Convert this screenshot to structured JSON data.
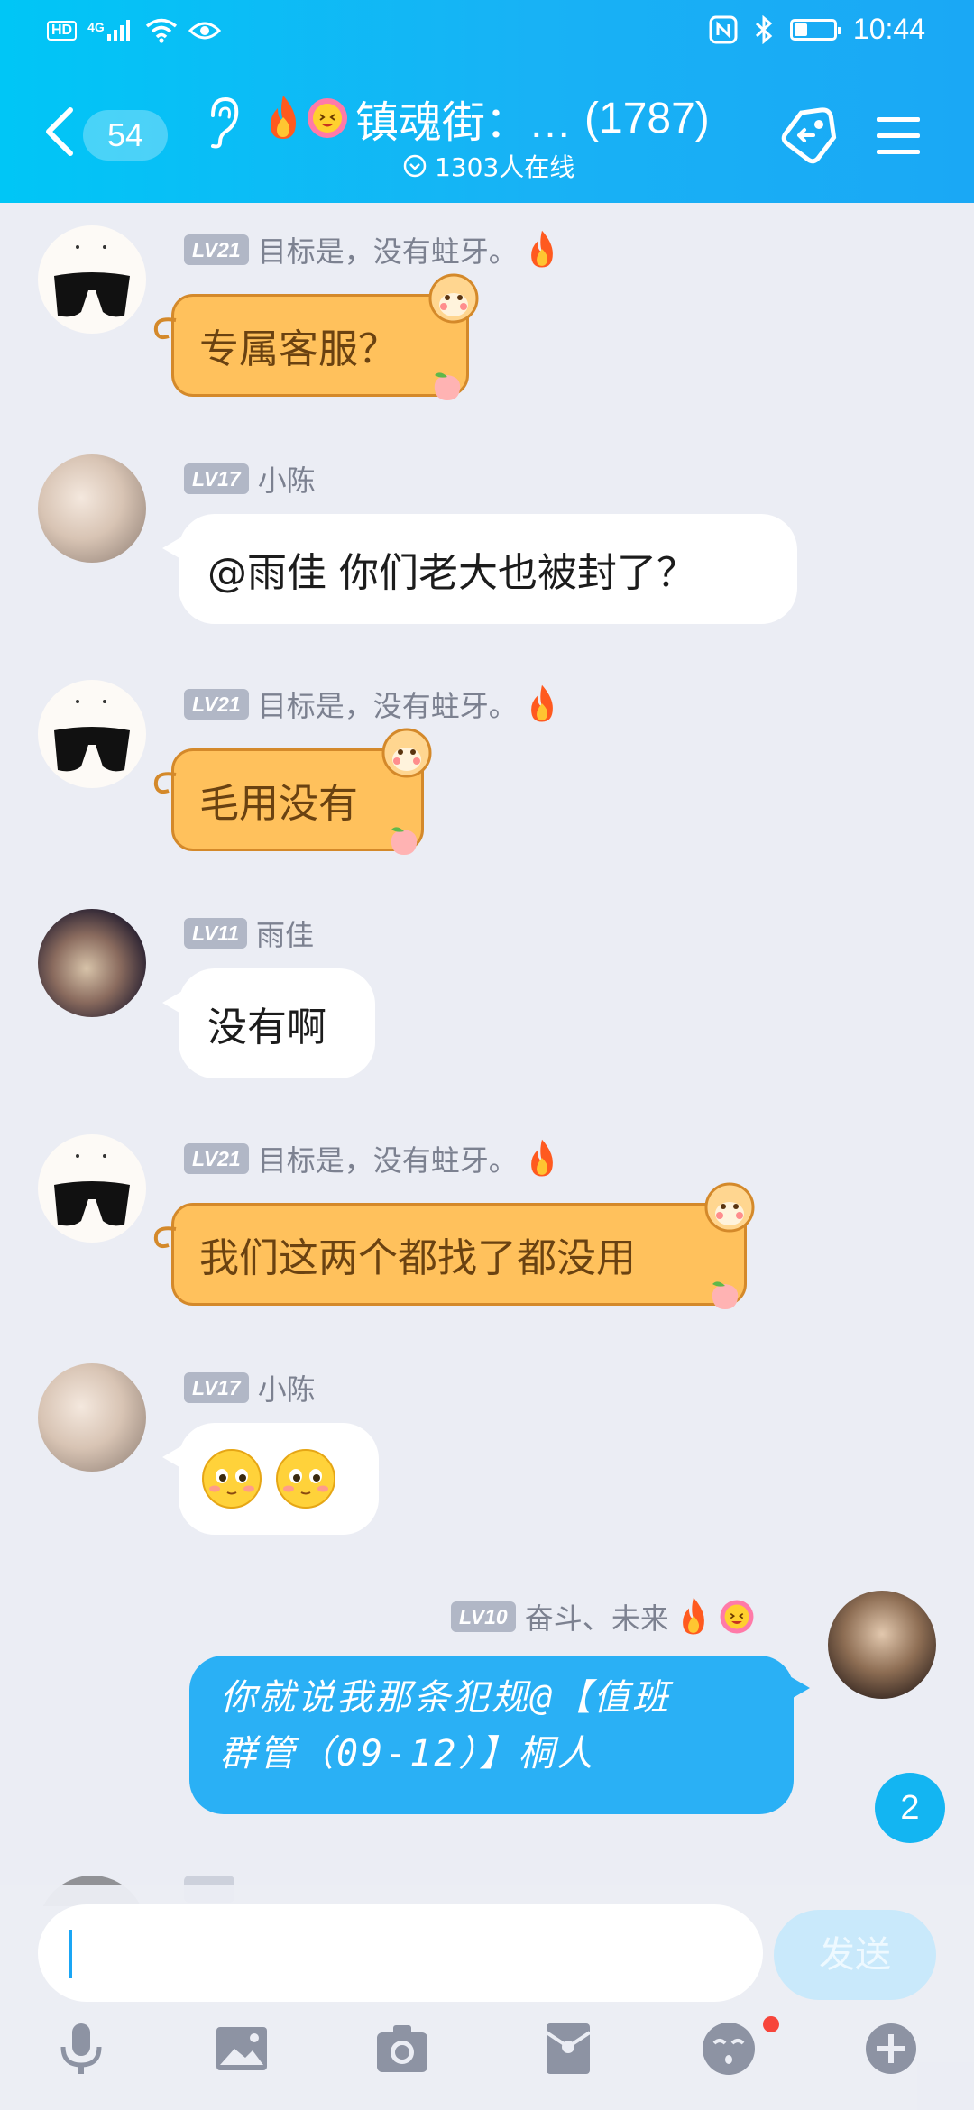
{
  "status_bar": {
    "time": "10:44",
    "network": "4G",
    "hd": "HD",
    "icons": [
      "hd-icon",
      "signal-icon",
      "wifi-icon",
      "eye-icon",
      "nfc-icon",
      "bluetooth-icon",
      "battery-icon"
    ]
  },
  "header": {
    "unread_count": "54",
    "title": "镇魂街：…",
    "member_count": "(1787)",
    "online_text": "1303人在线",
    "icons": [
      "back-icon",
      "ear-icon",
      "fire-icon",
      "laughing-emoji-icon",
      "online-check-icon",
      "tag-icon",
      "menu-icon"
    ]
  },
  "messages": [
    {
      "level": "LV21",
      "nickname": "目标是，没有蛀牙。",
      "text": "专属客服？",
      "style": "yellow"
    },
    {
      "level": "LV17",
      "nickname": "小陈",
      "text": "@雨佳 你们老大也被封了？",
      "style": "white"
    },
    {
      "level": "LV21",
      "nickname": "目标是，没有蛀牙。",
      "text": "毛用没有",
      "style": "yellow"
    },
    {
      "level": "LV11",
      "nickname": "雨佳",
      "text": "没有啊",
      "style": "white"
    },
    {
      "level": "LV21",
      "nickname": "目标是，没有蛀牙。",
      "text": "我们这两个都找了都没用",
      "style": "yellow"
    },
    {
      "level": "LV17",
      "nickname": "小陈",
      "text": "",
      "style": "white",
      "emojis": [
        "blushing-emoji-icon",
        "blushing-emoji-icon"
      ]
    },
    {
      "level": "LV10",
      "nickname": "奋斗、未来",
      "text_lines": [
        "你就说我那条犯规@【值班",
        "群管（09-12）】桐人"
      ],
      "style": "blue"
    }
  ],
  "new_message_count": "2",
  "input": {
    "placeholder": "",
    "send_label": "发送"
  },
  "toolbar": [
    "microphone-icon",
    "image-icon",
    "camera-icon",
    "red-packet-icon",
    "emoji-icon",
    "plus-icon"
  ],
  "colors": {
    "header_start": "#00c6f6",
    "header_end": "#1aa8f5",
    "background": "#ebedf4",
    "self_bubble": "#2ab0f5",
    "special_bubble": "#ffc15c",
    "badge": "#13b5f2"
  }
}
